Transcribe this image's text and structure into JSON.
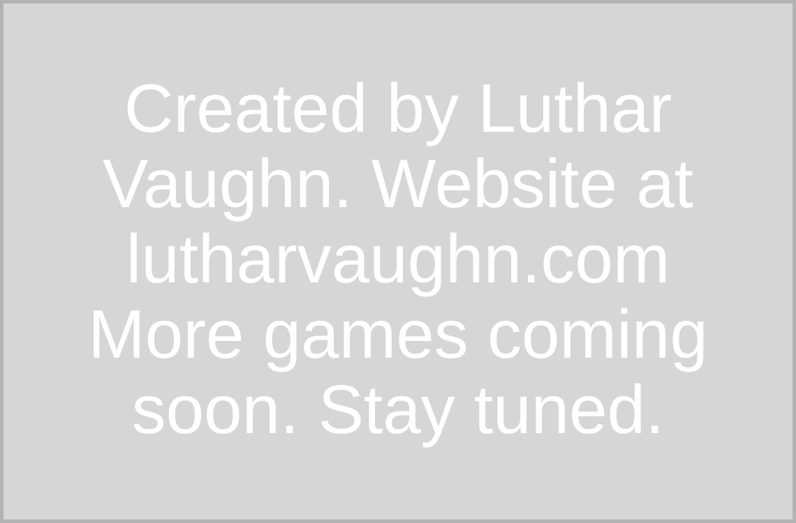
{
  "credits": {
    "lines": [
      "Created by Luthar",
      "Vaughn. Website at",
      "lutharvaughn.com",
      "More games coming",
      "soon. Stay tuned."
    ]
  },
  "colors": {
    "background": "#d6d6d6",
    "border": "#b3b3b3",
    "text": "#ffffff"
  }
}
